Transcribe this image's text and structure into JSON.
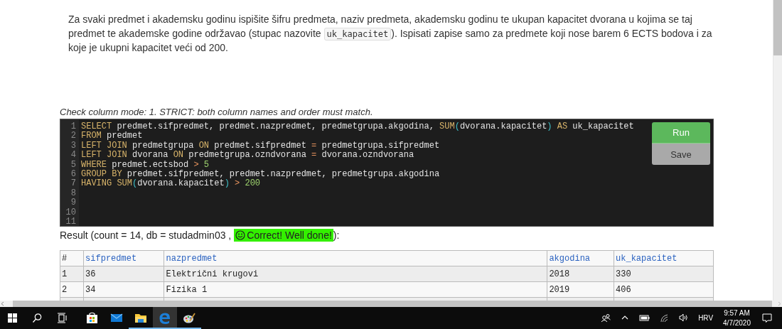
{
  "task": {
    "parts": [
      {
        "kind": "text",
        "text": "Za svaki predmet i akademsku godinu ispišite šifru predmeta, naziv predmeta, akademsku godinu te ukupan kapacitet dvorana u kojima se taj predmet te akademske godine održavao (stupac nazovite "
      },
      {
        "kind": "code",
        "text": "uk_kapacitet"
      },
      {
        "kind": "text",
        "text": "). Ispisati zapise samo za predmete koji nose barem 6 ECTS bodova i za koje je ukupni kapacitet veći od 200."
      }
    ]
  },
  "check_mode": "Check column mode: 1. STRICT: both column names and order must match.",
  "editor": {
    "lines": [
      {
        "number": "1",
        "tokens": [
          {
            "kind": "keyword",
            "text": "SELECT"
          },
          {
            "kind": "ident",
            "text": " predmet.sifpredmet, predmet.nazpredmet, predmetgrupa.akgodina, "
          },
          {
            "kind": "keyword",
            "text": "SUM"
          },
          {
            "kind": "paren",
            "text": "("
          },
          {
            "kind": "ident",
            "text": "dvorana.kapacitet"
          },
          {
            "kind": "paren",
            "text": ")"
          },
          {
            "kind": "keyword",
            "text": " AS"
          },
          {
            "kind": "ident",
            "text": " uk_kapacitet"
          }
        ]
      },
      {
        "number": "2",
        "tokens": [
          {
            "kind": "keyword",
            "text": "FROM"
          },
          {
            "kind": "ident",
            "text": " predmet"
          }
        ]
      },
      {
        "number": "3",
        "tokens": [
          {
            "kind": "keyword",
            "text": "LEFT JOIN"
          },
          {
            "kind": "ident",
            "text": " predmetgrupa "
          },
          {
            "kind": "keyword",
            "text": "ON"
          },
          {
            "kind": "ident",
            "text": " predmet.sifpredmet "
          },
          {
            "kind": "operator",
            "text": "="
          },
          {
            "kind": "ident",
            "text": " predmetgrupa.sifpredmet"
          }
        ]
      },
      {
        "number": "4",
        "tokens": [
          {
            "kind": "keyword",
            "text": "LEFT JOIN"
          },
          {
            "kind": "ident",
            "text": " dvorana "
          },
          {
            "kind": "keyword",
            "text": "ON"
          },
          {
            "kind": "ident",
            "text": " predmetgrupa.ozndvorana "
          },
          {
            "kind": "operator",
            "text": "="
          },
          {
            "kind": "ident",
            "text": " dvorana.ozndvorana"
          }
        ]
      },
      {
        "number": "5",
        "tokens": [
          {
            "kind": "keyword",
            "text": "WHERE"
          },
          {
            "kind": "ident",
            "text": " predmet.ectsbod "
          },
          {
            "kind": "operator",
            "text": ">"
          },
          {
            "kind": "number",
            "text": " 5"
          }
        ]
      },
      {
        "number": "6",
        "tokens": [
          {
            "kind": "keyword",
            "text": "GROUP BY"
          },
          {
            "kind": "ident",
            "text": " predmet.sifpredmet, predmet.nazpredmet, predmetgrupa.akgodina"
          }
        ]
      },
      {
        "number": "7",
        "tokens": [
          {
            "kind": "keyword",
            "text": "HAVING SUM"
          },
          {
            "kind": "paren",
            "text": "("
          },
          {
            "kind": "ident",
            "text": "dvorana.kapacitet"
          },
          {
            "kind": "paren",
            "text": ")"
          },
          {
            "kind": "operator",
            "text": " >"
          },
          {
            "kind": "number",
            "text": " 200"
          }
        ]
      },
      {
        "number": "8"
      },
      {
        "number": "9"
      },
      {
        "number": "10"
      },
      {
        "number": "11"
      }
    ],
    "buttons": [
      {
        "kind": "primary",
        "label": "Run"
      },
      {
        "kind": "secondary",
        "label": "Save"
      }
    ]
  },
  "result": {
    "prefix": "Result (count = 14, db = studadmin03 ,",
    "status": "Correct! Well done!",
    "correct": true,
    "suffix": "):"
  },
  "table": {
    "columns": [
      {
        "kind": "index",
        "label": "#"
      },
      {
        "kind": "field",
        "label": "sifpredmet"
      },
      {
        "kind": "field",
        "label": "nazpredmet"
      },
      {
        "kind": "field",
        "label": "akgodina"
      },
      {
        "kind": "field",
        "label": "uk_kapacitet"
      }
    ],
    "rows": [
      [
        "1",
        "36",
        "Električni krugovi",
        "2018",
        "330"
      ],
      [
        "2",
        "34",
        "Fizika 1",
        "2019",
        "406"
      ]
    ]
  },
  "taskbar": {
    "buttons": [
      {
        "kind": "start"
      },
      {
        "kind": "search"
      },
      {
        "kind": "taskview"
      }
    ],
    "apps": [
      {
        "kind": "store",
        "running": false,
        "active": false
      },
      {
        "kind": "mail",
        "running": false,
        "active": false
      },
      {
        "kind": "folder",
        "running": true,
        "active": false
      },
      {
        "kind": "browser",
        "running": true,
        "active": true
      },
      {
        "kind": "paint",
        "running": true,
        "active": false
      }
    ],
    "tray": {
      "language": "HRV",
      "time": "9:57 AM",
      "date": "4/7/2020"
    }
  }
}
